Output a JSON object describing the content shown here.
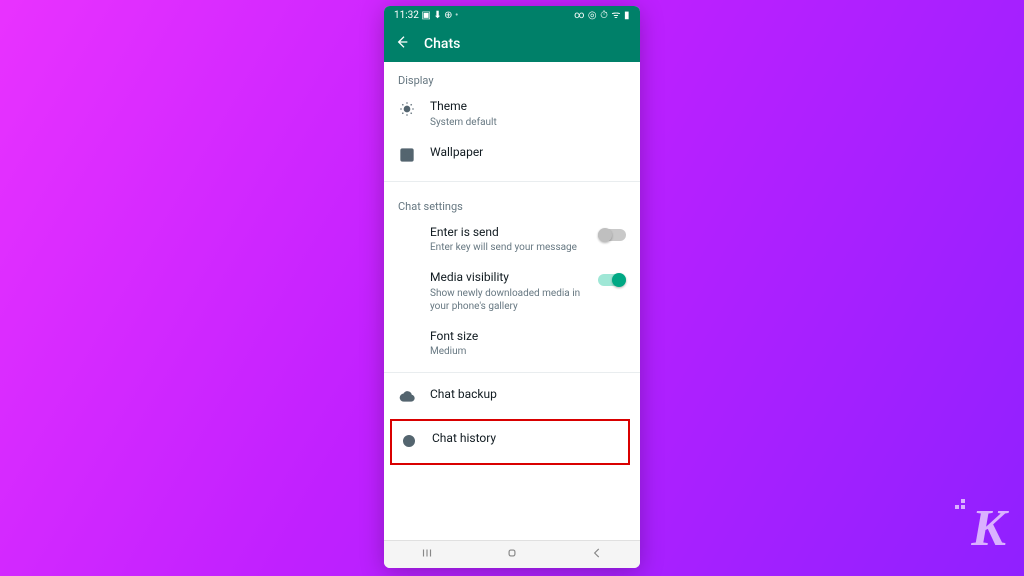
{
  "statusbar": {
    "time": "11:32",
    "indicators_left": "▣ ⬇ ⊕",
    "indicators_right": "∞ ◎ ⏱ ᯤ ▮"
  },
  "header": {
    "title": "Chats"
  },
  "sections": {
    "display": {
      "label": "Display",
      "theme": {
        "title": "Theme",
        "subtitle": "System default"
      },
      "wallpaper": {
        "title": "Wallpaper"
      }
    },
    "chat_settings": {
      "label": "Chat settings",
      "enter_is_send": {
        "title": "Enter is send",
        "subtitle": "Enter key will send your message",
        "enabled": false
      },
      "media_visibility": {
        "title": "Media visibility",
        "subtitle": "Show newly downloaded media in your phone's gallery",
        "enabled": true
      },
      "font_size": {
        "title": "Font size",
        "subtitle": "Medium"
      }
    },
    "other": {
      "chat_backup": {
        "title": "Chat backup"
      },
      "chat_history": {
        "title": "Chat history"
      }
    }
  },
  "watermark": "K"
}
